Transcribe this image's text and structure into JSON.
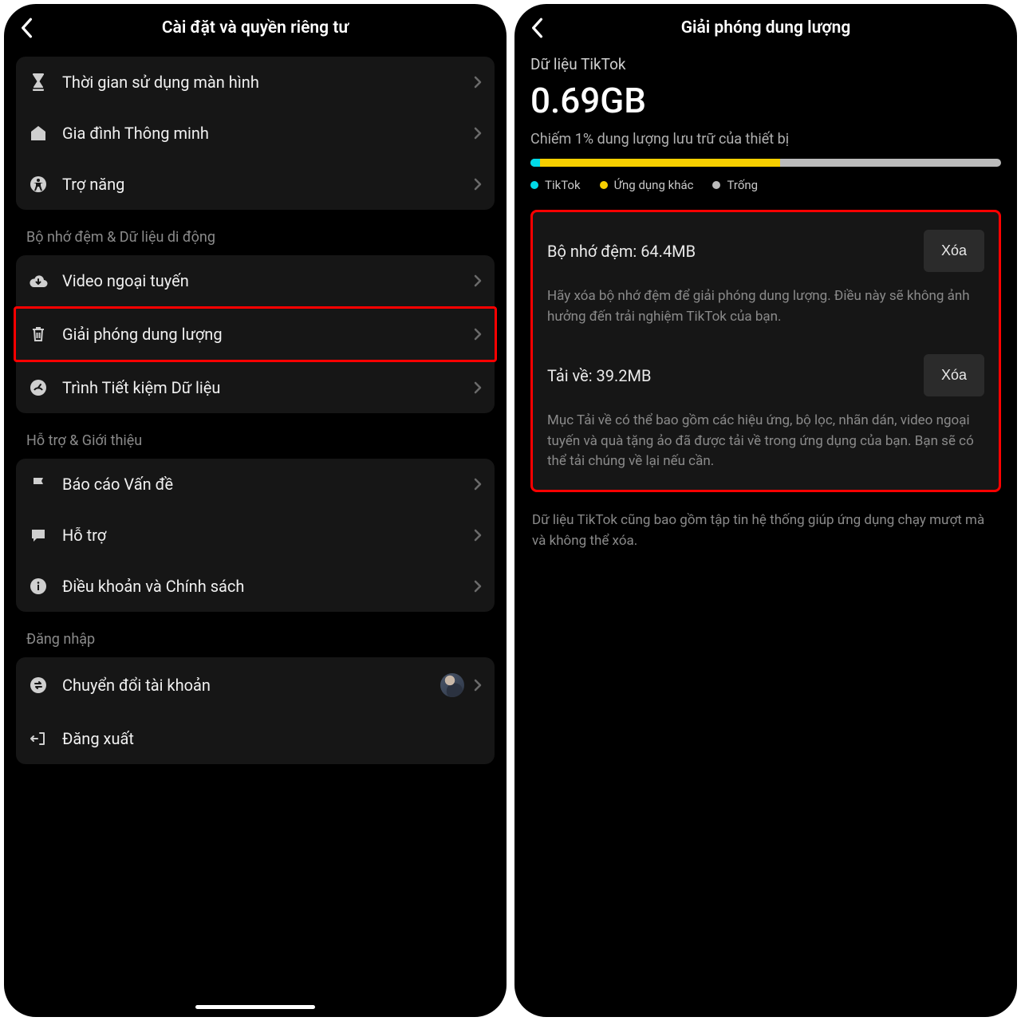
{
  "left": {
    "title": "Cài đặt và quyền riêng tư",
    "groups": [
      {
        "items": [
          {
            "label": "Thời gian sử dụng màn hình"
          },
          {
            "label": "Gia đình Thông minh"
          },
          {
            "label": "Trợ năng"
          }
        ]
      }
    ],
    "section_cache": "Bộ nhớ đệm & Dữ liệu di động",
    "cache_items": [
      {
        "label": "Video ngoại tuyến"
      },
      {
        "label": "Giải phóng dung lượng"
      },
      {
        "label": "Trình Tiết kiệm Dữ liệu"
      }
    ],
    "section_support": "Hỗ trợ & Giới thiệu",
    "support_items": [
      {
        "label": "Báo cáo Vấn đề"
      },
      {
        "label": "Hỗ trợ"
      },
      {
        "label": "Điều khoản và Chính sách"
      }
    ],
    "section_login": "Đăng nhập",
    "login_items": [
      {
        "label": "Chuyển đổi tài khoản"
      },
      {
        "label": "Đăng xuất"
      }
    ]
  },
  "right": {
    "title": "Giải phóng dung lượng",
    "data_label": "Dữ liệu TikTok",
    "size": "0.69GB",
    "usage_text": "Chiếm 1% dung lượng lưu trữ của thiết bị",
    "legend": {
      "tiktok": "TikTok",
      "other": "Ứng dụng khác",
      "free": "Trống"
    },
    "cache": {
      "title": "Bộ nhớ đệm: 64.4MB",
      "button": "Xóa",
      "desc": "Hãy xóa bộ nhớ đệm để giải phóng dung lượng. Điều này sẽ không ảnh hưởng đến trải nghiệm TikTok của bạn."
    },
    "download": {
      "title": "Tải về: 39.2MB",
      "button": "Xóa",
      "desc": "Mục Tải về có thể bao gồm các hiệu ứng, bộ lọc, nhãn dán, video ngoại tuyến và quà tặng ảo đã được tải về trong ứng dụng của bạn. Bạn sẽ có thể tải chúng về lại nếu cần."
    },
    "footer": "Dữ liệu TikTok cũng bao gồm tập tin hệ thống giúp ứng dụng chạy mượt mà và không thể xóa."
  }
}
